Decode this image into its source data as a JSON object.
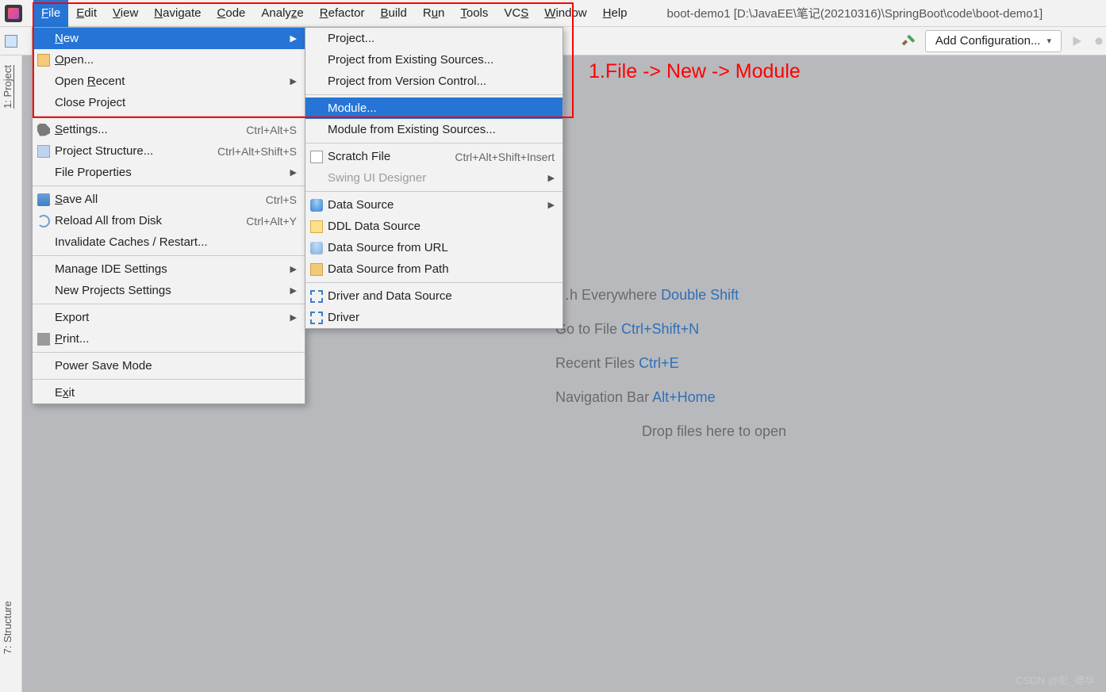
{
  "menubar": {
    "items": [
      {
        "label": "File",
        "mn": "F"
      },
      {
        "label": "Edit",
        "mn": "E"
      },
      {
        "label": "View",
        "mn": "V"
      },
      {
        "label": "Navigate",
        "mn": "N"
      },
      {
        "label": "Code",
        "mn": "C"
      },
      {
        "label": "Analyze",
        "mn": ""
      },
      {
        "label": "Refactor",
        "mn": "R"
      },
      {
        "label": "Build",
        "mn": "B"
      },
      {
        "label": "Run",
        "mn": "u"
      },
      {
        "label": "Tools",
        "mn": "T"
      },
      {
        "label": "VCS",
        "mn": "S"
      },
      {
        "label": "Window",
        "mn": "W"
      },
      {
        "label": "Help",
        "mn": "H"
      }
    ],
    "title": "boot-demo1 [D:\\JavaEE\\笔记(20210316)\\SpringBoot\\code\\boot-demo1]"
  },
  "toolbar": {
    "add_config": "Add Configuration..."
  },
  "sidebar": {
    "project": "1: Project",
    "structure": "7: Structure"
  },
  "file_menu": {
    "new": "New",
    "open": "Open...",
    "open_recent": "Open Recent",
    "close_project": "Close Project",
    "settings": "Settings...",
    "settings_sc": "Ctrl+Alt+S",
    "proj_struct": "Project Structure...",
    "proj_struct_sc": "Ctrl+Alt+Shift+S",
    "file_props": "File Properties",
    "save_all": "Save All",
    "save_all_sc": "Ctrl+S",
    "reload": "Reload All from Disk",
    "reload_sc": "Ctrl+Alt+Y",
    "invalidate": "Invalidate Caches / Restart...",
    "manage_ide": "Manage IDE Settings",
    "new_proj_settings": "New Projects Settings",
    "export": "Export",
    "print": "Print...",
    "power_save": "Power Save Mode",
    "exit": "Exit"
  },
  "new_menu": {
    "project": "Project...",
    "proj_existing": "Project from Existing Sources...",
    "proj_vcs": "Project from Version Control...",
    "module": "Module...",
    "mod_existing": "Module from Existing Sources...",
    "scratch": "Scratch File",
    "scratch_sc": "Ctrl+Alt+Shift+Insert",
    "swing": "Swing UI Designer",
    "data_source": "Data Source",
    "ddl": "DDL Data Source",
    "ds_url": "Data Source from URL",
    "ds_path": "Data Source from Path",
    "driver_ds": "Driver and Data Source",
    "driver": "Driver"
  },
  "annotation": "1.File -> New -> Module",
  "hints": {
    "search": "Search Everywhere",
    "search_kb": "Double Shift",
    "gotofile": "Go to File",
    "gotofile_kb": "Ctrl+Shift+N",
    "recent": "Recent Files",
    "recent_kb": "Ctrl+E",
    "nav": "Navigation Bar",
    "nav_kb": "Alt+Home",
    "drop": "Drop files here to open"
  },
  "watermark": "CSDN @彭_德华"
}
